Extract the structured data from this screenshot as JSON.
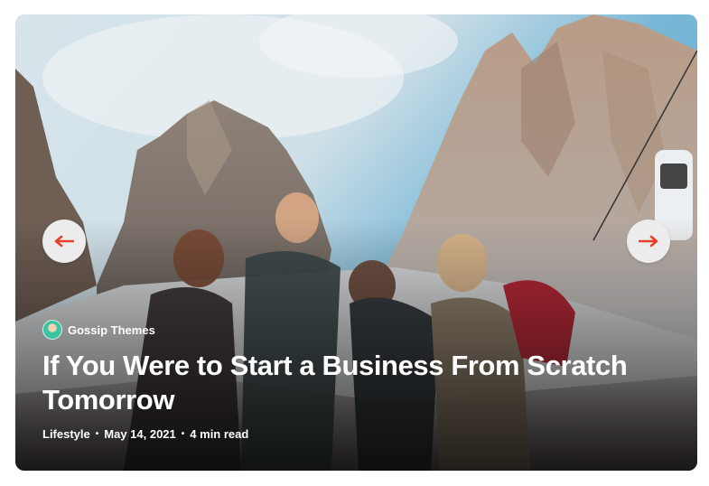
{
  "slide": {
    "author": "Gossip Themes",
    "title": "If You Were to Start a Business From Scratch Tomorrow",
    "category": "Lifestyle",
    "date": "May 14, 2021",
    "read_time": "4 min read",
    "separator": "•"
  },
  "nav": {
    "prev_icon": "arrow-left-icon",
    "next_icon": "arrow-right-icon",
    "accent_color": "#e8402a"
  },
  "colors": {
    "sky": "#7fb6d6",
    "rock": "#b7a79a",
    "text": "#ffffff",
    "button_bg": "#ececec"
  }
}
